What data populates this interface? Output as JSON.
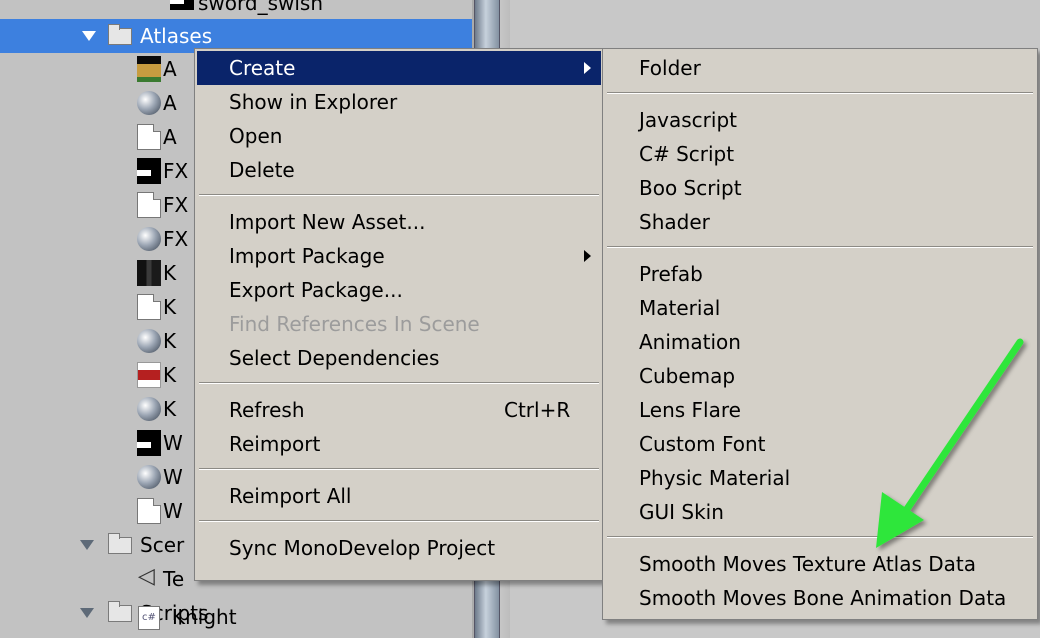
{
  "project_tree": {
    "top_cut_label": "sword_swish",
    "atlases_label": "Atlases",
    "asset_letters": [
      "A",
      "A",
      "A",
      "FX",
      "FX",
      "FX",
      "K",
      "K",
      "K",
      "K",
      "K",
      "W",
      "W",
      "W"
    ],
    "scenes_label": "Scer",
    "scene_item_letter": "Te",
    "scripts_label": "Scripts",
    "script_item_label": "Knight"
  },
  "context_menu": {
    "create": "Create",
    "show_in_explorer": "Show in Explorer",
    "open": "Open",
    "delete": "Delete",
    "import_new_asset": "Import New Asset...",
    "import_package": "Import Package",
    "export_package": "Export Package...",
    "find_references": "Find References In Scene",
    "select_dependencies": "Select Dependencies",
    "refresh": "Refresh",
    "refresh_shortcut": "Ctrl+R",
    "reimport": "Reimport",
    "reimport_all": "Reimport All",
    "sync_monodevelop": "Sync MonoDevelop Project"
  },
  "create_submenu": {
    "folder": "Folder",
    "javascript": "Javascript",
    "csharp_script": "C# Script",
    "boo_script": "Boo Script",
    "shader": "Shader",
    "prefab": "Prefab",
    "material": "Material",
    "animation": "Animation",
    "cubemap": "Cubemap",
    "lens_flare": "Lens Flare",
    "custom_font": "Custom Font",
    "physic_material": "Physic Material",
    "gui_skin": "GUI Skin",
    "smooth_moves_atlas": "Smooth Moves Texture Atlas Data",
    "smooth_moves_bone": "Smooth Moves Bone Animation Data"
  },
  "colors": {
    "menu_bg": "#d4d0c8",
    "menu_highlight": "#0a246a",
    "tree_selection": "#3d80df",
    "annotation_arrow": "#2ee63a"
  }
}
